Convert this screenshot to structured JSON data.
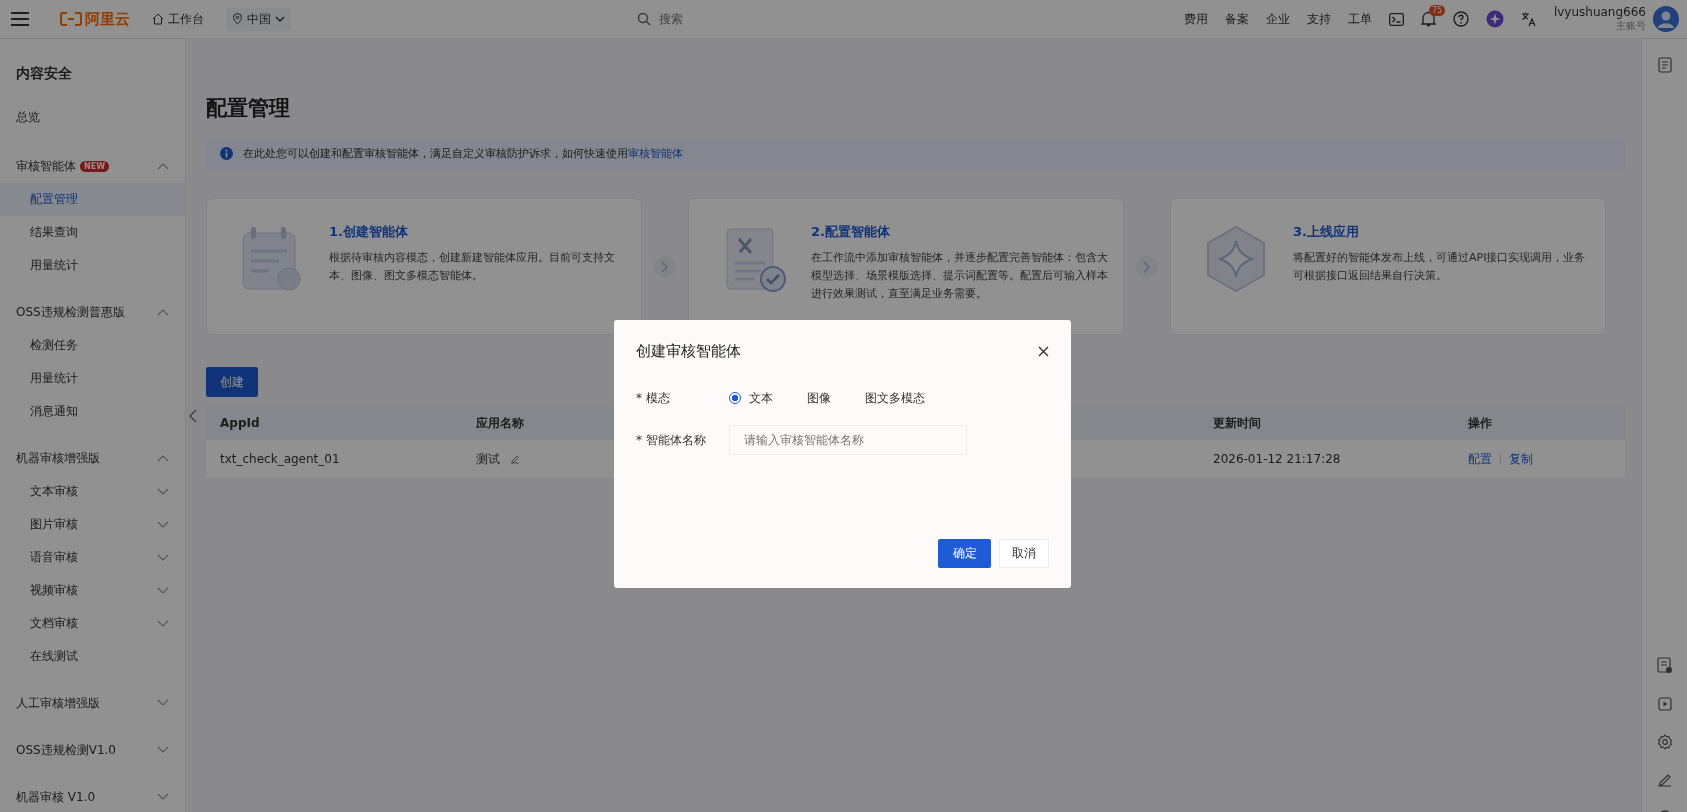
{
  "topbar": {
    "logo": "阿里云",
    "workbench": "工作台",
    "region": "中国",
    "search": {
      "placeholder": "搜索"
    },
    "links": [
      "费用",
      "备案",
      "企业",
      "支持",
      "工单"
    ],
    "notification_count": "75",
    "user": {
      "name": "lvyushuang666",
      "role": "主账号"
    }
  },
  "sidebar": {
    "title": "内容安全",
    "overview": "总览",
    "groups": [
      {
        "label": "审核智能体",
        "badge": "NEW",
        "expanded": true,
        "children": [
          {
            "label": "配置管理",
            "selected": true,
            "expandable": false
          },
          {
            "label": "结果查询",
            "selected": false,
            "expandable": false
          },
          {
            "label": "用量统计",
            "selected": false,
            "expandable": false
          }
        ]
      },
      {
        "label": "OSS违规检测普惠版",
        "expanded": true,
        "children": [
          {
            "label": "检测任务",
            "selected": false,
            "expandable": false
          },
          {
            "label": "用量统计",
            "selected": false,
            "expandable": false
          },
          {
            "label": "消息通知",
            "selected": false,
            "expandable": false
          }
        ]
      },
      {
        "label": "机器审核增强版",
        "expanded": true,
        "children": [
          {
            "label": "文本审核",
            "selected": false,
            "expandable": true
          },
          {
            "label": "图片审核",
            "selected": false,
            "expandable": true
          },
          {
            "label": "语音审核",
            "selected": false,
            "expandable": true
          },
          {
            "label": "视频审核",
            "selected": false,
            "expandable": true
          },
          {
            "label": "文档审核",
            "selected": false,
            "expandable": true
          },
          {
            "label": "在线测试",
            "selected": false,
            "expandable": false
          }
        ]
      },
      {
        "label": "人工审核增强版",
        "expanded": false
      },
      {
        "label": "OSS违规检测V1.0",
        "expanded": false
      },
      {
        "label": "机器审核 V1.0",
        "expanded": false
      }
    ]
  },
  "page": {
    "title": "配置管理",
    "notice": {
      "text": "在此处您可以创建和配置审核智能体，满足自定义审核防护诉求，如何快速使用",
      "link": "审核智能体"
    },
    "steps": [
      {
        "kind": "create",
        "title": "1.创建智能体",
        "description": "根据待审核内容模态，创建新建智能体应用。目前可支持文本、图像、图文多模态智能体。"
      },
      {
        "kind": "configure",
        "title": "2.配置智能体",
        "description": "在工作流中添加审核智能体，并逐步配置完善智能体：包含大模型选择、场景模版选择、提示词配置等。配置后可输入样本进行效果测试，直至满足业务需要。"
      },
      {
        "kind": "publish",
        "title": "3.上线应用",
        "description": "将配置好的智能体发布上线，可通过API接口实现调用，业务可根据接口返回结果自行决策。"
      }
    ],
    "create_button": "创建",
    "table": {
      "columns": [
        "AppId",
        "应用名称",
        "更新时间",
        "操作"
      ],
      "rows": [
        {
          "appid": "txt_check_agent_01",
          "name": "测试",
          "updated": "2026-01-12 21:17:28",
          "actions": [
            "配置",
            "复制"
          ]
        }
      ]
    }
  },
  "dialog": {
    "title": "创建审核智能体",
    "fields": [
      {
        "kind": "radio",
        "label": "* 模态",
        "options": [
          {
            "label": "文本",
            "selected": true
          },
          {
            "label": "图像",
            "selected": false
          },
          {
            "label": "图文多模态",
            "selected": false
          }
        ]
      },
      {
        "kind": "text",
        "label": "* 智能体名称",
        "placeholder": "请输入审核智能体名称"
      }
    ],
    "buttons": [
      {
        "label": "确定",
        "primary": true
      },
      {
        "label": "取消",
        "primary": false
      }
    ]
  }
}
